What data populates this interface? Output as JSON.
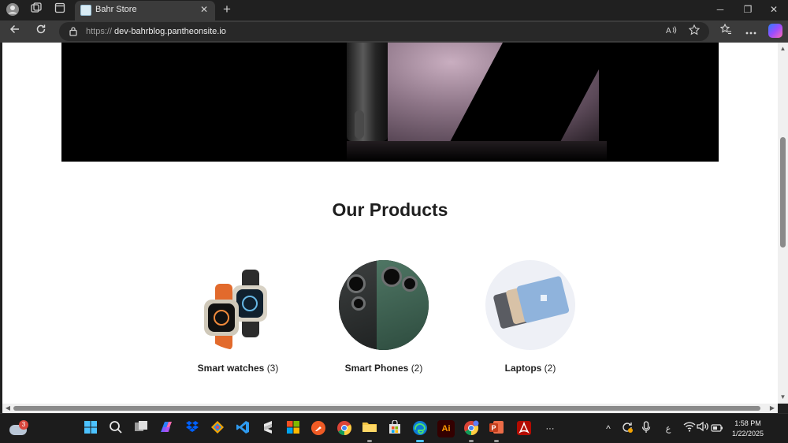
{
  "browser": {
    "tab_title": "Bahr Store",
    "tab_close": "✕",
    "new_tab": "+",
    "window": {
      "minimize": "─",
      "maximize": "❐",
      "close": "✕"
    },
    "address": {
      "scheme": "https://",
      "host": "dev-bahrblog.pantheonsite.io"
    },
    "icons": {
      "profile": "profile-icon",
      "workspaces": "workspaces-icon",
      "tab_actions": "tab-actions-icon",
      "back": "back-arrow-icon",
      "refresh": "refresh-icon",
      "lock": "lock-icon",
      "read_aloud": "read-aloud-icon",
      "favorite": "star-icon",
      "favorites": "favorites-icon",
      "more": "more-icon",
      "copilot": "copilot-icon"
    }
  },
  "page": {
    "section_title": "Our Products",
    "products": [
      {
        "name": "Smart watches",
        "count": "(3)"
      },
      {
        "name": "Smart Phones",
        "count": "(2)"
      },
      {
        "name": "Laptops",
        "count": "(2)"
      }
    ]
  },
  "taskbar": {
    "weather_badge": "3",
    "apps": [
      {
        "name": "start",
        "color": "#2f8cf0"
      },
      {
        "name": "search",
        "color": "#1c1c1c"
      },
      {
        "name": "task-view",
        "color": "#1c1c1c"
      },
      {
        "name": "copilot",
        "color": "#6b5cff"
      },
      {
        "name": "dropbox",
        "color": "#0061fe"
      },
      {
        "name": "sourcetree",
        "color": "#2d4b8b"
      },
      {
        "name": "vscode",
        "color": "#1c1c1c"
      },
      {
        "name": "sublime",
        "color": "#1c1c1c"
      },
      {
        "name": "microsoft-store-grid",
        "color": "#1c1c1c"
      },
      {
        "name": "postman",
        "color": "#ef5b25"
      },
      {
        "name": "chrome",
        "color": "#1c1c1c"
      },
      {
        "name": "file-explorer",
        "color": "#f4c542"
      },
      {
        "name": "store",
        "color": "#1c1c1c"
      },
      {
        "name": "edge",
        "color": "#1c1c1c"
      },
      {
        "name": "illustrator",
        "color": "#330000"
      },
      {
        "name": "chrome-profile",
        "color": "#1c1c1c"
      },
      {
        "name": "powerpoint",
        "color": "#c43e1c"
      },
      {
        "name": "acrobat",
        "color": "#b30b00"
      },
      {
        "name": "more-apps",
        "color": "#1c1c1c"
      }
    ],
    "app_text": {
      "illustrator": "Ai",
      "more": "···"
    },
    "tray": {
      "chevron": "^",
      "lang": "ع"
    },
    "clock": {
      "time": "1:58 PM",
      "date": "1/22/2025"
    }
  }
}
